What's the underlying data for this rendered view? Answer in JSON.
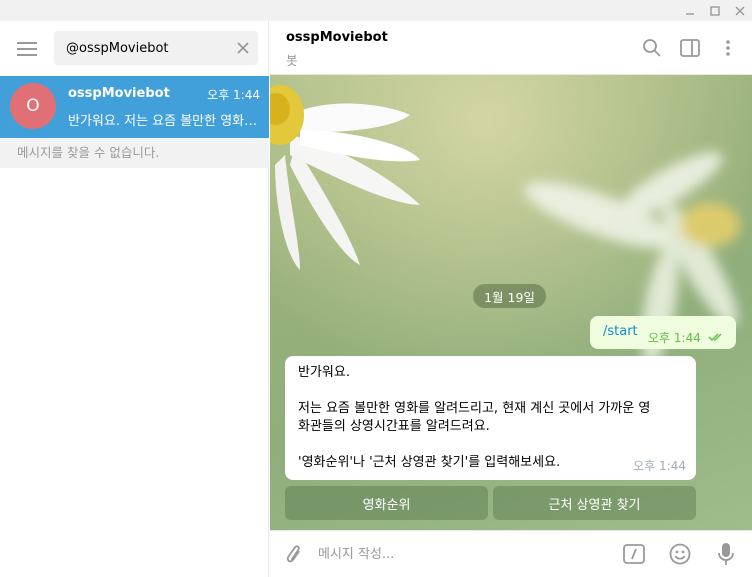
{
  "search": {
    "value": "@osspMoviebot"
  },
  "chat_list": [
    {
      "avatar_letter": "O",
      "name": "osspMoviebot",
      "time": "오후 1:44",
      "preview": "반가워요.  저는 요즘 볼만한 영화를 알려드리고, 현재 계신 곳에서 가까운 영화관들의 상영시간표를 알려드려요."
    }
  ],
  "no_results": "메시지를 찾을 수 없습니다.",
  "header": {
    "name": "osspMoviebot",
    "status": "봇"
  },
  "date_divider": "1월 19일",
  "outgoing": {
    "text": "/start",
    "time": "오후 1:44"
  },
  "incoming": {
    "lines": [
      "반가워요.",
      "",
      "저는 요즘 볼만한 영화를 알려드리고, 현재 계신 곳에서 가까운 영",
      "화관들의 상영시간표를 알려드려요.",
      "",
      "'영화순위'나 '근처 상영관 찾기'를 입력해보세요."
    ],
    "time": "오후 1:44"
  },
  "keyboard": [
    "영화순위",
    "근처 상영관 찾기"
  ],
  "compose": {
    "placeholder": "메시지 작성..."
  },
  "colors": {
    "accent": "#419fd9",
    "avatar": "#e17076",
    "out_bubble": "#effdde",
    "link": "#168acd"
  }
}
